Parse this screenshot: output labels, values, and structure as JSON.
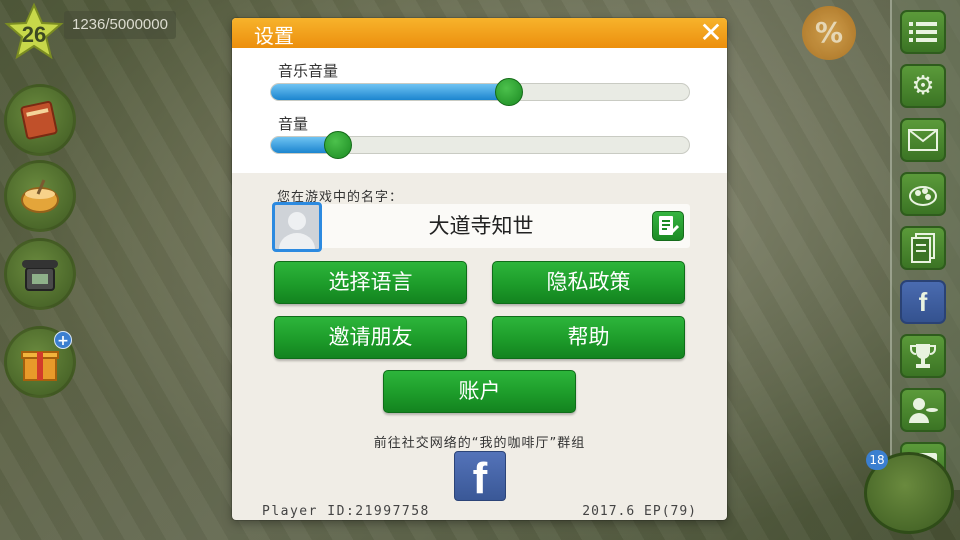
{
  "hud": {
    "level": "26",
    "xp": "1236/5000000",
    "percent_icon": "%",
    "cup_badge": "18"
  },
  "left_buttons": [
    {
      "icon": "recipe-book-icon"
    },
    {
      "icon": "cooking-pot-icon"
    },
    {
      "icon": "telephone-icon"
    },
    {
      "icon": "gift-icon"
    }
  ],
  "sidebar": {
    "buttons": [
      {
        "icon": "menu-list-icon"
      },
      {
        "icon": "gears-icon"
      },
      {
        "icon": "mail-icon"
      },
      {
        "icon": "food-plate-icon"
      },
      {
        "icon": "documents-icon"
      },
      {
        "icon": "facebook-icon",
        "glyph": "f"
      },
      {
        "icon": "trophy-icon"
      },
      {
        "icon": "waiter-icon"
      },
      {
        "icon": "chat-icon"
      }
    ]
  },
  "dialog": {
    "title": "设置",
    "close_glyph": "✕",
    "music_volume": {
      "label": "音乐音量",
      "level_percent": 57
    },
    "sound_volume": {
      "label": "音量",
      "level_percent": 16
    },
    "name_label": "您在游戏中的名字：",
    "player_name": "大道寺知世",
    "buttons": {
      "language": "选择语言",
      "privacy": "隐私政策",
      "invite": "邀请朋友",
      "help": "帮助",
      "account": "账户"
    },
    "social_label": "前往社交网络的“我的咖啡厅”群组",
    "facebook_glyph": "f",
    "player_id": "Player ID:21997758",
    "version": "2017.6 EP(79)"
  },
  "colors": {
    "header_orange": "#ec8f0d",
    "button_green": "#1d9c2a",
    "slider_blue": "#1c85cf",
    "facebook_blue": "#3a5897"
  }
}
